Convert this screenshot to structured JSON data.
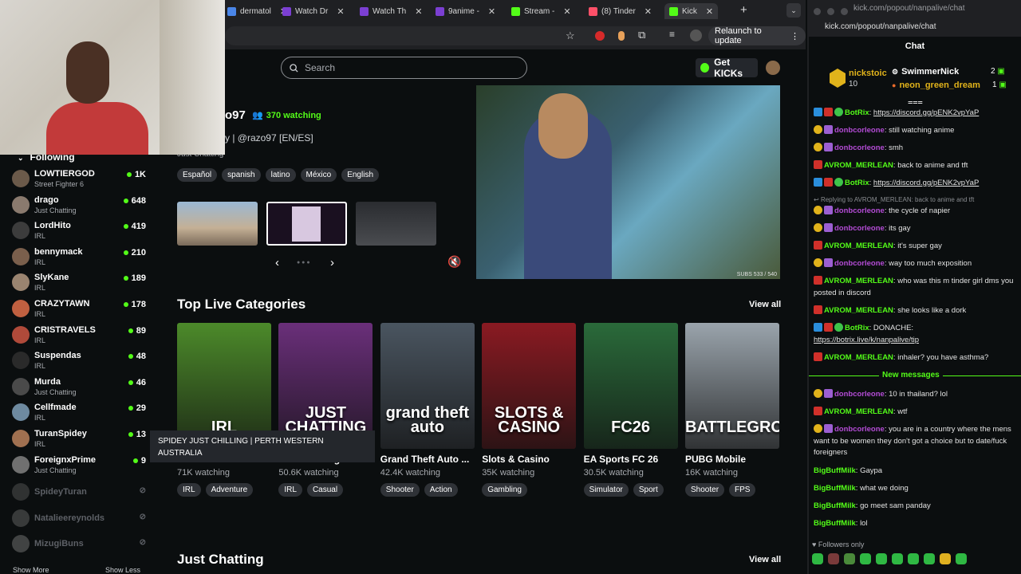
{
  "browser": {
    "tabs": [
      {
        "label": "dermatol",
        "color": "#4a86e8"
      },
      {
        "label": "Watch Dr",
        "color": "#7b3fd2"
      },
      {
        "label": "Watch Th",
        "color": "#7b3fd2"
      },
      {
        "label": "9anime -",
        "color": "#7b3fd2"
      },
      {
        "label": "Stream -",
        "color": "#53fc18"
      },
      {
        "label": "(8) Tinder",
        "color": "#fd5068"
      },
      {
        "label": "Kick",
        "color": "#53fc18"
      }
    ],
    "new_tab": "+",
    "relaunch_label": "Relaunch to update"
  },
  "header": {
    "search_placeholder": "Search",
    "get_kicks_label": "Get KICKs"
  },
  "sidebar": {
    "heading": "Following",
    "items": [
      {
        "name": "LOWTIERGOD",
        "category": "Street Fighter 6",
        "viewers": "1K",
        "avatar": "#6b5a4a"
      },
      {
        "name": "drago",
        "category": "Just Chatting",
        "viewers": "648",
        "avatar": "#8a7a6e"
      },
      {
        "name": "LordHito",
        "category": "IRL",
        "viewers": "419",
        "avatar": "#3c3c3c"
      },
      {
        "name": "bennymack",
        "category": "IRL",
        "viewers": "210",
        "avatar": "#7a5f4c"
      },
      {
        "name": "SlyKane",
        "category": "IRL",
        "viewers": "189",
        "avatar": "#9a8470"
      },
      {
        "name": "CRAZYTAWN",
        "category": "IRL",
        "viewers": "178",
        "avatar": "#c06040"
      },
      {
        "name": "CRISTRAVELS",
        "category": "IRL",
        "viewers": "89",
        "avatar": "#b04a3a"
      },
      {
        "name": "Suspendas",
        "category": "IRL",
        "viewers": "48",
        "avatar": "#2a2a2a"
      },
      {
        "name": "Murda",
        "category": "Just Chatting",
        "viewers": "46",
        "avatar": "#4a4a4a"
      },
      {
        "name": "Cellfmade",
        "category": "IRL",
        "viewers": "29",
        "avatar": "#6e8aa0"
      },
      {
        "name": "TuranSpidey",
        "category": "IRL",
        "viewers": "13",
        "avatar": "#a07050"
      },
      {
        "name": "ForeignxPrime",
        "category": "Just Chatting",
        "viewers": "9",
        "avatar": "#707070"
      }
    ],
    "offline": [
      {
        "name": "SpideyTuran",
        "avatar": "#555555"
      },
      {
        "name": "Natalieereynolds",
        "avatar": "#666666"
      },
      {
        "name": "MizugiBuns",
        "avatar": "#777777"
      }
    ],
    "show_more": "Show More",
    "show_less": "Show Less",
    "tooltip": "SPIDEY JUST CHILLING | PERTH WESTERN AUSTRALIA"
  },
  "featured": {
    "channel": "o97",
    "watching": "370 watching",
    "subtitle": "y | @razo97 [EN/ES]",
    "category": "Just Chatting",
    "tags": [
      "Español",
      "spanish",
      "latino",
      "México",
      "English"
    ],
    "subs_overlay": "SUBS 533 / 540"
  },
  "sections": {
    "top_categories": "Top Live Categories",
    "view_all": "View all",
    "just_chatting": "Just Chatting"
  },
  "categories": [
    {
      "name": "IRL",
      "watching": "71K watching",
      "tags": [
        "IRL",
        "Adventure"
      ],
      "art": "IRL",
      "bg": "#4c8a2a"
    },
    {
      "name": "Just Chatting",
      "watching": "50.6K watching",
      "tags": [
        "IRL",
        "Casual"
      ],
      "art": "JUST CHATTING",
      "bg": "#6a2f7a"
    },
    {
      "name": "Grand Theft Auto ...",
      "watching": "42.4K watching",
      "tags": [
        "Shooter",
        "Action"
      ],
      "art": "grand theft auto",
      "bg": "#4a5560"
    },
    {
      "name": "Slots & Casino",
      "watching": "35K watching",
      "tags": [
        "Gambling"
      ],
      "art": "SLOTS & CASINO",
      "bg": "#8a1a22"
    },
    {
      "name": "EA Sports FC 26",
      "watching": "30.5K watching",
      "tags": [
        "Simulator",
        "Sport"
      ],
      "art": "FC26",
      "bg": "#2a6a3a"
    },
    {
      "name": "PUBG Mobile",
      "watching": "16K watching",
      "tags": [
        "Shooter",
        "FPS"
      ],
      "art": "BATTLEGROUNDS",
      "bg": "#9aa4ac"
    }
  ],
  "chat": {
    "url": "kick.com/popout/nanpalive/chat",
    "title": "Chat",
    "top_gifters": [
      {
        "name": "nickstoic",
        "count": "10"
      },
      {
        "name": "SwimmerNick",
        "count": "2"
      },
      {
        "name": "neon_green_dream",
        "count": "1"
      }
    ],
    "replying_to": "Replying to AVROM_MERLEAN: back to anime and tft",
    "new_messages": "New messages",
    "followers_only": "Followers only",
    "messages": [
      {
        "user": "BotRix",
        "color": "#53fc18",
        "badges": [
          "blue",
          "red",
          "ver"
        ],
        "text": "https://discord.gg/pENK2vpYaP",
        "link": true
      },
      {
        "user": "donbcorleone",
        "color": "#b44cd6",
        "badges": [
          "coin",
          "dock"
        ],
        "text": "still watching anime"
      },
      {
        "user": "donbcorleone",
        "color": "#b44cd6",
        "badges": [
          "coin",
          "dock"
        ],
        "text": "smh"
      },
      {
        "user": "AVROM_MERLEAN",
        "color": "#53fc18",
        "badges": [
          "red"
        ],
        "text": "back to anime and tft"
      },
      {
        "user": "BotRix",
        "color": "#53fc18",
        "badges": [
          "blue",
          "red",
          "ver"
        ],
        "text": "https://discord.gg/pENK2vpYaP",
        "link": true
      },
      {
        "user": "donbcorleone",
        "color": "#b44cd6",
        "badges": [
          "coin",
          "dock"
        ],
        "text": "the cycle of napier"
      },
      {
        "user": "donbcorleone",
        "color": "#b44cd6",
        "badges": [
          "coin",
          "dock"
        ],
        "text": "its gay"
      },
      {
        "user": "AVROM_MERLEAN",
        "color": "#53fc18",
        "badges": [
          "red"
        ],
        "text": "it's super gay"
      },
      {
        "user": "donbcorleone",
        "color": "#b44cd6",
        "badges": [
          "coin",
          "dock"
        ],
        "text": "way too much exposition"
      },
      {
        "user": "AVROM_MERLEAN",
        "color": "#53fc18",
        "badges": [
          "red"
        ],
        "text": "who was this m tinder girl dms you posted in discord"
      },
      {
        "user": "AVROM_MERLEAN",
        "color": "#53fc18",
        "badges": [
          "red"
        ],
        "text": "she looks like a dork"
      },
      {
        "user": "BotRix",
        "color": "#53fc18",
        "badges": [
          "blue",
          "red",
          "ver"
        ],
        "text": "DONACHE:",
        "link2": "https://botrix.live/k/nanpalive/tip"
      },
      {
        "user": "AVROM_MERLEAN",
        "color": "#53fc18",
        "badges": [
          "red"
        ],
        "text": "inhaler? you have asthma?"
      },
      {
        "user": "donbcorleone",
        "color": "#b44cd6",
        "badges": [
          "coin",
          "dock"
        ],
        "text": "10 in thailand? lol"
      },
      {
        "user": "AVROM_MERLEAN",
        "color": "#53fc18",
        "badges": [
          "red"
        ],
        "text": "wtf"
      },
      {
        "user": "donbcorleone",
        "color": "#b44cd6",
        "badges": [
          "coin",
          "dock"
        ],
        "text": "you are in a country where the mens want to be women they don't got a choice but to date/fuck foreigners"
      },
      {
        "user": "BigBuffMilk",
        "color": "#53fc18",
        "badges": [],
        "text": "Gaypa"
      },
      {
        "user": "BigBuffMilk",
        "color": "#53fc18",
        "badges": [],
        "text": "what we doing"
      },
      {
        "user": "BigBuffMilk",
        "color": "#53fc18",
        "badges": [],
        "text": "go meet sam panday"
      },
      {
        "user": "BigBuffMilk",
        "color": "#53fc18",
        "badges": [],
        "text": "lol"
      }
    ]
  }
}
